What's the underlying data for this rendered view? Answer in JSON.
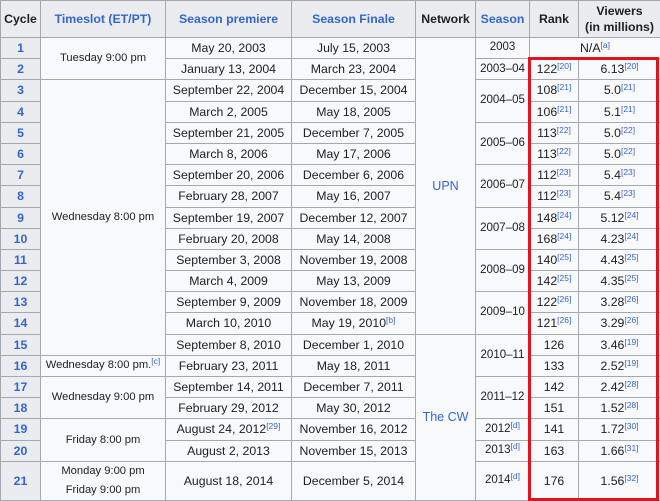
{
  "headers": {
    "cycle": "Cycle",
    "timeslot": "Timeslot (ET/PT)",
    "premiere": "Season premiere",
    "finale": "Season Finale",
    "network": "Network",
    "season": "Season",
    "rank": "Rank",
    "viewers_line1": "Viewers",
    "viewers_line2": "(in millions)"
  },
  "timeslots": {
    "t1": "Tuesday 9:00 pm",
    "t2": "Wednesday 8:00 pm",
    "t3": "Wednesday 8:00 pm.",
    "t3_ref": "[c]",
    "t4": "Wednesday 9:00 pm",
    "t5": "Friday 8:00 pm",
    "t6a": "Monday 9:00 pm",
    "t6b": "Friday 9:00 pm"
  },
  "networks": {
    "upn": "UPN",
    "cw": "The CW"
  },
  "seasons": {
    "s2003": "2003",
    "s0304": "2003–04",
    "s0405": "2004–05",
    "s0506": "2005–06",
    "s0607": "2006–07",
    "s0708": "2007–08",
    "s0809": "2008–09",
    "s0910": "2009–10",
    "s1011": "2010–11",
    "s1112": "2011–12",
    "s2012": "2012",
    "s2012_ref": "[d]",
    "s2013": "2013",
    "s2013_ref": "[d]",
    "s2014": "2014",
    "s2014_ref": "[d]"
  },
  "na": {
    "text": "N/A",
    "ref": "[a]"
  },
  "rows": [
    {
      "cycle": "1",
      "premiere": "May 20, 2003",
      "finale": "July 15, 2003",
      "finale_ref": ""
    },
    {
      "cycle": "2",
      "premiere": "January 13, 2004",
      "finale": "March 23, 2004",
      "finale_ref": "",
      "rank": "122",
      "rank_ref": "[20]",
      "viewers": "6.13",
      "viewers_ref": "[20]"
    },
    {
      "cycle": "3",
      "premiere": "September 22, 2004",
      "finale": "December 15, 2004",
      "finale_ref": "",
      "rank": "108",
      "rank_ref": "[21]",
      "viewers": "5.0",
      "viewers_ref": "[21]"
    },
    {
      "cycle": "4",
      "premiere": "March 2, 2005",
      "finale": "May 18, 2005",
      "finale_ref": "",
      "rank": "106",
      "rank_ref": "[21]",
      "viewers": "5.1",
      "viewers_ref": "[21]"
    },
    {
      "cycle": "5",
      "premiere": "September 21, 2005",
      "finale": "December 7, 2005",
      "finale_ref": "",
      "rank": "113",
      "rank_ref": "[22]",
      "viewers": "5.0",
      "viewers_ref": "[22]"
    },
    {
      "cycle": "6",
      "premiere": "March 8, 2006",
      "finale": "May 17, 2006",
      "finale_ref": "",
      "rank": "113",
      "rank_ref": "[22]",
      "viewers": "5.0",
      "viewers_ref": "[22]"
    },
    {
      "cycle": "7",
      "premiere": "September 20, 2006",
      "finale": "December 6, 2006",
      "finale_ref": "",
      "rank": "112",
      "rank_ref": "[23]",
      "viewers": "5.4",
      "viewers_ref": "[23]"
    },
    {
      "cycle": "8",
      "premiere": "February 28, 2007",
      "finale": "May 16, 2007",
      "finale_ref": "",
      "rank": "112",
      "rank_ref": "[23]",
      "viewers": "5.4",
      "viewers_ref": "[23]"
    },
    {
      "cycle": "9",
      "premiere": "September 19, 2007",
      "finale": "December 12, 2007",
      "finale_ref": "",
      "rank": "148",
      "rank_ref": "[24]",
      "viewers": "5.12",
      "viewers_ref": "[24]"
    },
    {
      "cycle": "10",
      "premiere": "February 20, 2008",
      "finale": "May 14, 2008",
      "finale_ref": "",
      "rank": "168",
      "rank_ref": "[24]",
      "viewers": "4.23",
      "viewers_ref": "[24]"
    },
    {
      "cycle": "11",
      "premiere": "September 3, 2008",
      "finale": "November 19, 2008",
      "finale_ref": "",
      "rank": "140",
      "rank_ref": "[25]",
      "viewers": "4.43",
      "viewers_ref": "[25]"
    },
    {
      "cycle": "12",
      "premiere": "March 4, 2009",
      "finale": "May 13, 2009",
      "finale_ref": "",
      "rank": "142",
      "rank_ref": "[25]",
      "viewers": "4.35",
      "viewers_ref": "[25]"
    },
    {
      "cycle": "13",
      "premiere": "September 9, 2009",
      "finale": "November 18, 2009",
      "finale_ref": "",
      "rank": "122",
      "rank_ref": "[26]",
      "viewers": "3.28",
      "viewers_ref": "[26]"
    },
    {
      "cycle": "14",
      "premiere": "March 10, 2010",
      "finale": "May 19, 2010",
      "finale_ref": "[b]",
      "rank": "121",
      "rank_ref": "[26]",
      "viewers": "3.29",
      "viewers_ref": "[26]"
    },
    {
      "cycle": "15",
      "premiere": "September 8, 2010",
      "finale": "December 1, 2010",
      "finale_ref": "",
      "rank": "126",
      "rank_ref": "",
      "viewers": "3.46",
      "viewers_ref": "[19]"
    },
    {
      "cycle": "16",
      "premiere": "February 23, 2011",
      "finale": "May 18, 2011",
      "finale_ref": "",
      "rank": "133",
      "rank_ref": "",
      "viewers": "2.52",
      "viewers_ref": "[19]"
    },
    {
      "cycle": "17",
      "premiere": "September 14, 2011",
      "finale": "December 7, 2011",
      "finale_ref": "",
      "rank": "142",
      "rank_ref": "",
      "viewers": "2.42",
      "viewers_ref": "[28]"
    },
    {
      "cycle": "18",
      "premiere": "February 29, 2012",
      "finale": "May 30, 2012",
      "finale_ref": "",
      "rank": "151",
      "rank_ref": "",
      "viewers": "1.52",
      "viewers_ref": "[28]"
    },
    {
      "cycle": "19",
      "premiere": "August 24, 2012",
      "premiere_ref": "[29]",
      "finale": "November 16, 2012",
      "finale_ref": "",
      "rank": "141",
      "rank_ref": "",
      "viewers": "1.72",
      "viewers_ref": "[30]"
    },
    {
      "cycle": "20",
      "premiere": "August 2, 2013",
      "finale": "November 15, 2013",
      "finale_ref": "",
      "rank": "163",
      "rank_ref": "",
      "viewers": "1.66",
      "viewers_ref": "[31]"
    },
    {
      "cycle": "21",
      "premiere": "August 18, 2014",
      "finale": "December 5, 2014",
      "finale_ref": "",
      "rank": "176",
      "rank_ref": "",
      "viewers": "1.56",
      "viewers_ref": "[32]"
    }
  ],
  "colors": {
    "link": "#3366cc",
    "highlight_border": "#e0141c",
    "header_bg": "#eaecf0",
    "cell_bg": "#f8f9fa",
    "border": "#a2a9b1"
  }
}
